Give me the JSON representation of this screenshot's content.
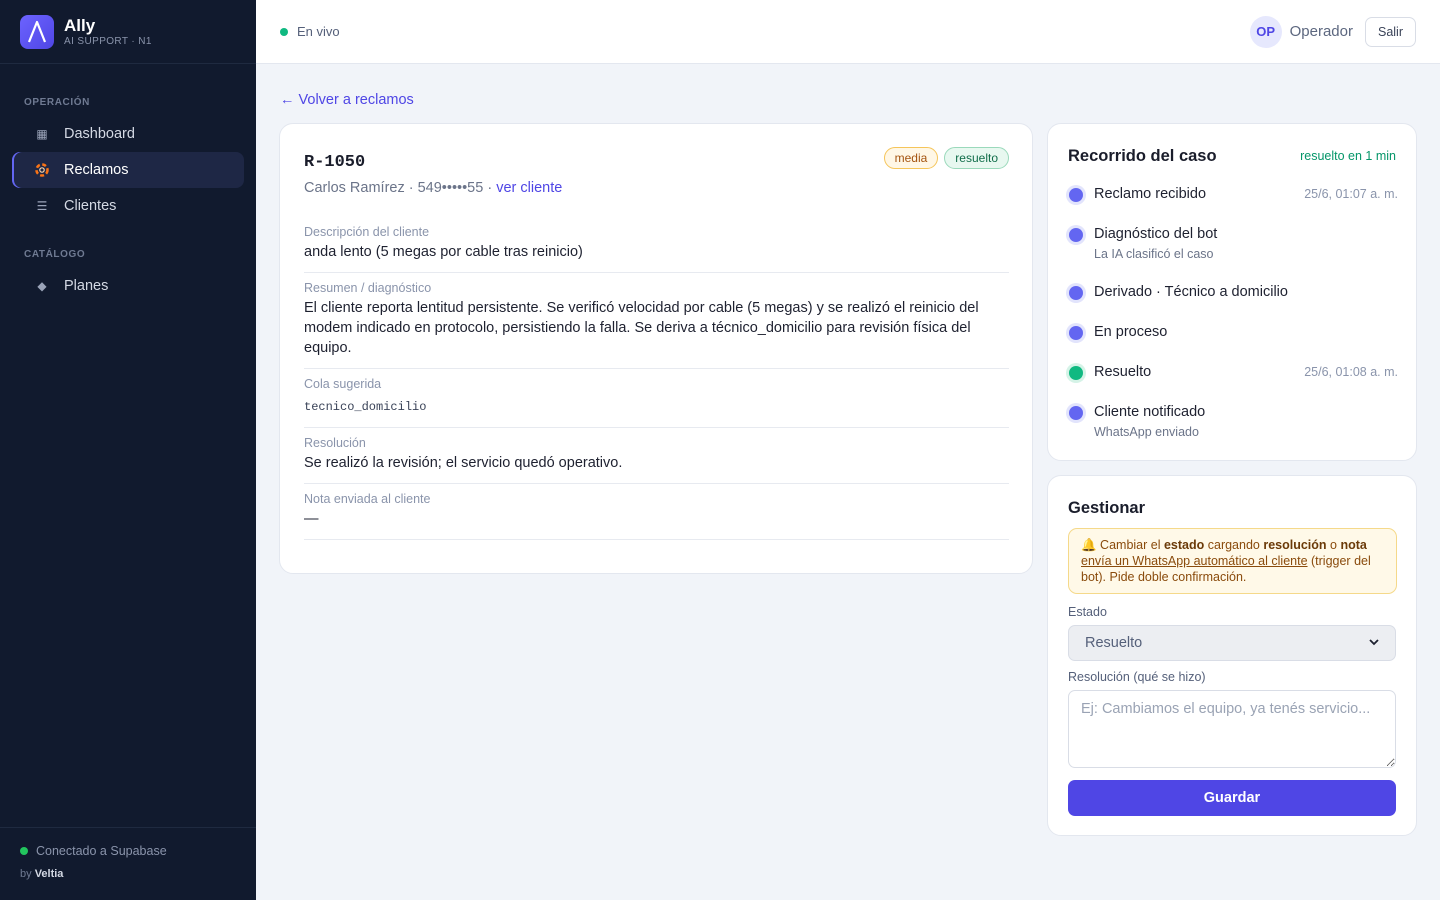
{
  "brand": {
    "name": "Ally",
    "subtitle": "AI SUPPORT · N1"
  },
  "sidebar": {
    "sections": [
      {
        "title": "OPERACIÓN"
      },
      {
        "title": "CATÁLOGO"
      }
    ],
    "items": [
      {
        "label": "Dashboard",
        "icon": "grid-icon",
        "active": false
      },
      {
        "label": "Reclamos",
        "icon": "lifebuoy-icon",
        "active": true
      },
      {
        "label": "Clientes",
        "icon": "list-icon",
        "active": false
      },
      {
        "label": "Planes",
        "icon": "diamond-icon",
        "active": false
      }
    ],
    "footer": {
      "status": "Conectado a Supabase",
      "by_prefix": "by",
      "by_name": "Veltia"
    }
  },
  "topbar": {
    "live": "En vivo",
    "avatar": "OP",
    "user": "Operador",
    "logout": "Salir"
  },
  "back_link": "← Volver a reclamos",
  "claim": {
    "id": "R-1050",
    "priority": "media",
    "status": "resuelto",
    "customer": "Carlos Ramírez · 549•••••55 · ",
    "customer_link": "ver cliente",
    "fields": [
      {
        "label": "Descripción del cliente",
        "value": "anda lento (5 megas por cable tras reinicio)"
      },
      {
        "label": "Resumen / diagnóstico",
        "value": "El cliente reporta lentitud persistente. Se verificó velocidad por cable (5 megas) y se realizó el reinicio del modem indicado en protocolo, persistiendo la falla. Se deriva a técnico_domicilio para revisión física del equipo."
      },
      {
        "label": "Cola sugerida",
        "value": "tecnico_domicilio"
      },
      {
        "label": "Resolución",
        "value": "Se realizó la revisión; el servicio quedó operativo."
      },
      {
        "label": "Nota enviada al cliente",
        "value": "—"
      }
    ]
  },
  "timeline": {
    "title": "Recorrido del caso",
    "meta": "resuelto en 1 min",
    "steps": [
      {
        "name": "Reclamo recibido",
        "sub": "",
        "time": "25/6, 01:07 a. m.",
        "color": "#6366f1"
      },
      {
        "name": "Diagnóstico del bot",
        "sub": "La IA clasificó el caso",
        "time": "",
        "color": "#6366f1"
      },
      {
        "name": "Derivado · Técnico a domicilio",
        "sub": "",
        "time": "",
        "color": "#6366f1"
      },
      {
        "name": "En proceso",
        "sub": "",
        "time": "",
        "color": "#6366f1"
      },
      {
        "name": "Resuelto",
        "sub": "",
        "time": "25/6, 01:08 a. m.",
        "color": "#10b981"
      },
      {
        "name": "Cliente notificado",
        "sub": "WhatsApp enviado",
        "time": "",
        "color": "#6366f1"
      }
    ]
  },
  "manage": {
    "title": "Gestionar",
    "warning": {
      "icon": "🔔",
      "p1": " Cambiar el ",
      "b1": "estado",
      "p2": " cargando ",
      "b2": "resolución",
      "p3": " o ",
      "b3": "nota",
      "u1": "envía un WhatsApp automático al cliente",
      "p4": " (trigger del bot). Pide doble confirmación."
    },
    "state_label": "Estado",
    "state_value": "Resuelto",
    "resolution_label": "Resolución (qué se hizo)",
    "resolution_placeholder": "Ej: Cambiamos el equipo, ya tenés servicio...",
    "save": "Guardar"
  },
  "colors": {
    "accent": "#4f46e5",
    "sidebar_bg": "#111a2e",
    "success": "#10b981"
  }
}
